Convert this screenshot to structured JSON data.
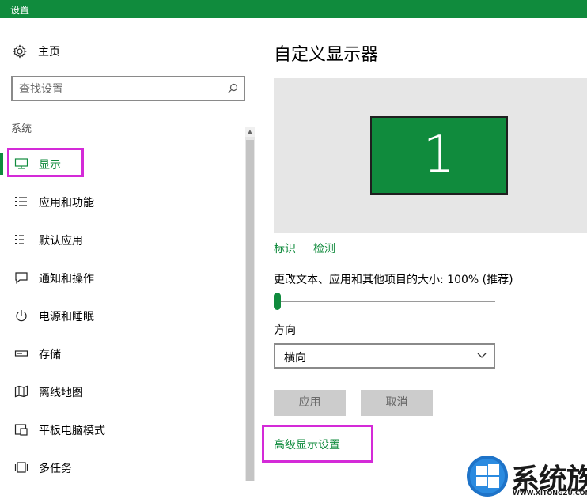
{
  "window": {
    "title": "设置"
  },
  "sidebar": {
    "home_label": "主页",
    "search_placeholder": "查找设置",
    "section_label": "系统",
    "items": [
      {
        "label": "显示",
        "icon": "monitor-icon",
        "active": true
      },
      {
        "label": "应用和功能",
        "icon": "list-icon"
      },
      {
        "label": "默认应用",
        "icon": "default-apps-icon"
      },
      {
        "label": "通知和操作",
        "icon": "notification-icon"
      },
      {
        "label": "电源和睡眠",
        "icon": "power-icon"
      },
      {
        "label": "存储",
        "icon": "storage-icon"
      },
      {
        "label": "离线地图",
        "icon": "map-icon"
      },
      {
        "label": "平板电脑模式",
        "icon": "tablet-icon"
      },
      {
        "label": "多任务",
        "icon": "multitask-icon"
      }
    ]
  },
  "main": {
    "title": "自定义显示器",
    "monitor_number": "1",
    "identify_link": "标识",
    "detect_link": "检测",
    "scale_label": "更改文本、应用和其他项目的大小: 100% (推荐)",
    "scale_slider_value": 0,
    "orientation_label": "方向",
    "orientation_value": "横向",
    "apply_button": "应用",
    "cancel_button": "取消",
    "advanced_link": "高级显示设置"
  },
  "watermark": {
    "text": "系统族",
    "url_text": "WWW.XITONGZU.COM"
  },
  "colors": {
    "accent": "#108b3d",
    "highlight": "#d42ad8",
    "preview_bg": "#e6e6e6",
    "disabled_button": "#cccccc"
  }
}
